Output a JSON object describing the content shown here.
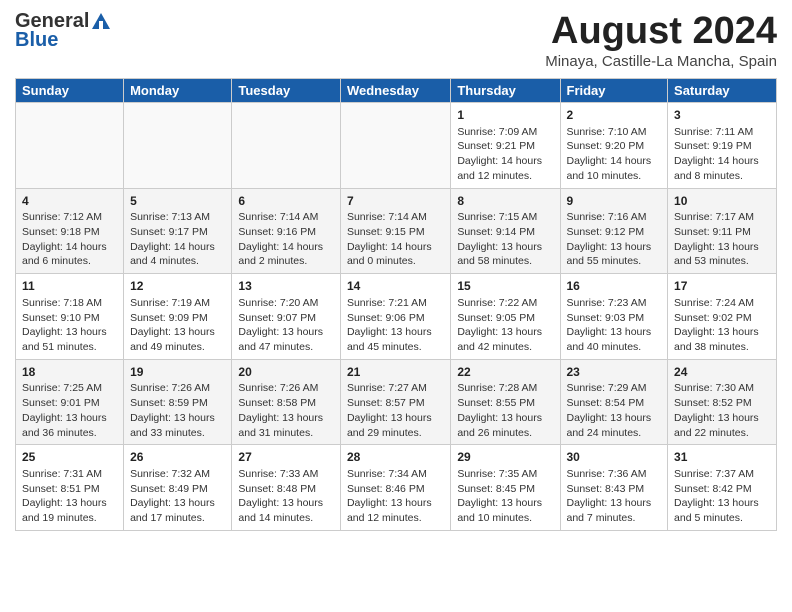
{
  "header": {
    "logo_general": "General",
    "logo_blue": "Blue",
    "month_year": "August 2024",
    "location": "Minaya, Castille-La Mancha, Spain"
  },
  "days_of_week": [
    "Sunday",
    "Monday",
    "Tuesday",
    "Wednesday",
    "Thursday",
    "Friday",
    "Saturday"
  ],
  "weeks": [
    [
      {
        "day": "",
        "info": ""
      },
      {
        "day": "",
        "info": ""
      },
      {
        "day": "",
        "info": ""
      },
      {
        "day": "",
        "info": ""
      },
      {
        "day": "1",
        "info": "Sunrise: 7:09 AM\nSunset: 9:21 PM\nDaylight: 14 hours\nand 12 minutes."
      },
      {
        "day": "2",
        "info": "Sunrise: 7:10 AM\nSunset: 9:20 PM\nDaylight: 14 hours\nand 10 minutes."
      },
      {
        "day": "3",
        "info": "Sunrise: 7:11 AM\nSunset: 9:19 PM\nDaylight: 14 hours\nand 8 minutes."
      }
    ],
    [
      {
        "day": "4",
        "info": "Sunrise: 7:12 AM\nSunset: 9:18 PM\nDaylight: 14 hours\nand 6 minutes."
      },
      {
        "day": "5",
        "info": "Sunrise: 7:13 AM\nSunset: 9:17 PM\nDaylight: 14 hours\nand 4 minutes."
      },
      {
        "day": "6",
        "info": "Sunrise: 7:14 AM\nSunset: 9:16 PM\nDaylight: 14 hours\nand 2 minutes."
      },
      {
        "day": "7",
        "info": "Sunrise: 7:14 AM\nSunset: 9:15 PM\nDaylight: 14 hours\nand 0 minutes."
      },
      {
        "day": "8",
        "info": "Sunrise: 7:15 AM\nSunset: 9:14 PM\nDaylight: 13 hours\nand 58 minutes."
      },
      {
        "day": "9",
        "info": "Sunrise: 7:16 AM\nSunset: 9:12 PM\nDaylight: 13 hours\nand 55 minutes."
      },
      {
        "day": "10",
        "info": "Sunrise: 7:17 AM\nSunset: 9:11 PM\nDaylight: 13 hours\nand 53 minutes."
      }
    ],
    [
      {
        "day": "11",
        "info": "Sunrise: 7:18 AM\nSunset: 9:10 PM\nDaylight: 13 hours\nand 51 minutes."
      },
      {
        "day": "12",
        "info": "Sunrise: 7:19 AM\nSunset: 9:09 PM\nDaylight: 13 hours\nand 49 minutes."
      },
      {
        "day": "13",
        "info": "Sunrise: 7:20 AM\nSunset: 9:07 PM\nDaylight: 13 hours\nand 47 minutes."
      },
      {
        "day": "14",
        "info": "Sunrise: 7:21 AM\nSunset: 9:06 PM\nDaylight: 13 hours\nand 45 minutes."
      },
      {
        "day": "15",
        "info": "Sunrise: 7:22 AM\nSunset: 9:05 PM\nDaylight: 13 hours\nand 42 minutes."
      },
      {
        "day": "16",
        "info": "Sunrise: 7:23 AM\nSunset: 9:03 PM\nDaylight: 13 hours\nand 40 minutes."
      },
      {
        "day": "17",
        "info": "Sunrise: 7:24 AM\nSunset: 9:02 PM\nDaylight: 13 hours\nand 38 minutes."
      }
    ],
    [
      {
        "day": "18",
        "info": "Sunrise: 7:25 AM\nSunset: 9:01 PM\nDaylight: 13 hours\nand 36 minutes."
      },
      {
        "day": "19",
        "info": "Sunrise: 7:26 AM\nSunset: 8:59 PM\nDaylight: 13 hours\nand 33 minutes."
      },
      {
        "day": "20",
        "info": "Sunrise: 7:26 AM\nSunset: 8:58 PM\nDaylight: 13 hours\nand 31 minutes."
      },
      {
        "day": "21",
        "info": "Sunrise: 7:27 AM\nSunset: 8:57 PM\nDaylight: 13 hours\nand 29 minutes."
      },
      {
        "day": "22",
        "info": "Sunrise: 7:28 AM\nSunset: 8:55 PM\nDaylight: 13 hours\nand 26 minutes."
      },
      {
        "day": "23",
        "info": "Sunrise: 7:29 AM\nSunset: 8:54 PM\nDaylight: 13 hours\nand 24 minutes."
      },
      {
        "day": "24",
        "info": "Sunrise: 7:30 AM\nSunset: 8:52 PM\nDaylight: 13 hours\nand 22 minutes."
      }
    ],
    [
      {
        "day": "25",
        "info": "Sunrise: 7:31 AM\nSunset: 8:51 PM\nDaylight: 13 hours\nand 19 minutes."
      },
      {
        "day": "26",
        "info": "Sunrise: 7:32 AM\nSunset: 8:49 PM\nDaylight: 13 hours\nand 17 minutes."
      },
      {
        "day": "27",
        "info": "Sunrise: 7:33 AM\nSunset: 8:48 PM\nDaylight: 13 hours\nand 14 minutes."
      },
      {
        "day": "28",
        "info": "Sunrise: 7:34 AM\nSunset: 8:46 PM\nDaylight: 13 hours\nand 12 minutes."
      },
      {
        "day": "29",
        "info": "Sunrise: 7:35 AM\nSunset: 8:45 PM\nDaylight: 13 hours\nand 10 minutes."
      },
      {
        "day": "30",
        "info": "Sunrise: 7:36 AM\nSunset: 8:43 PM\nDaylight: 13 hours\nand 7 minutes."
      },
      {
        "day": "31",
        "info": "Sunrise: 7:37 AM\nSunset: 8:42 PM\nDaylight: 13 hours\nand 5 minutes."
      }
    ]
  ]
}
